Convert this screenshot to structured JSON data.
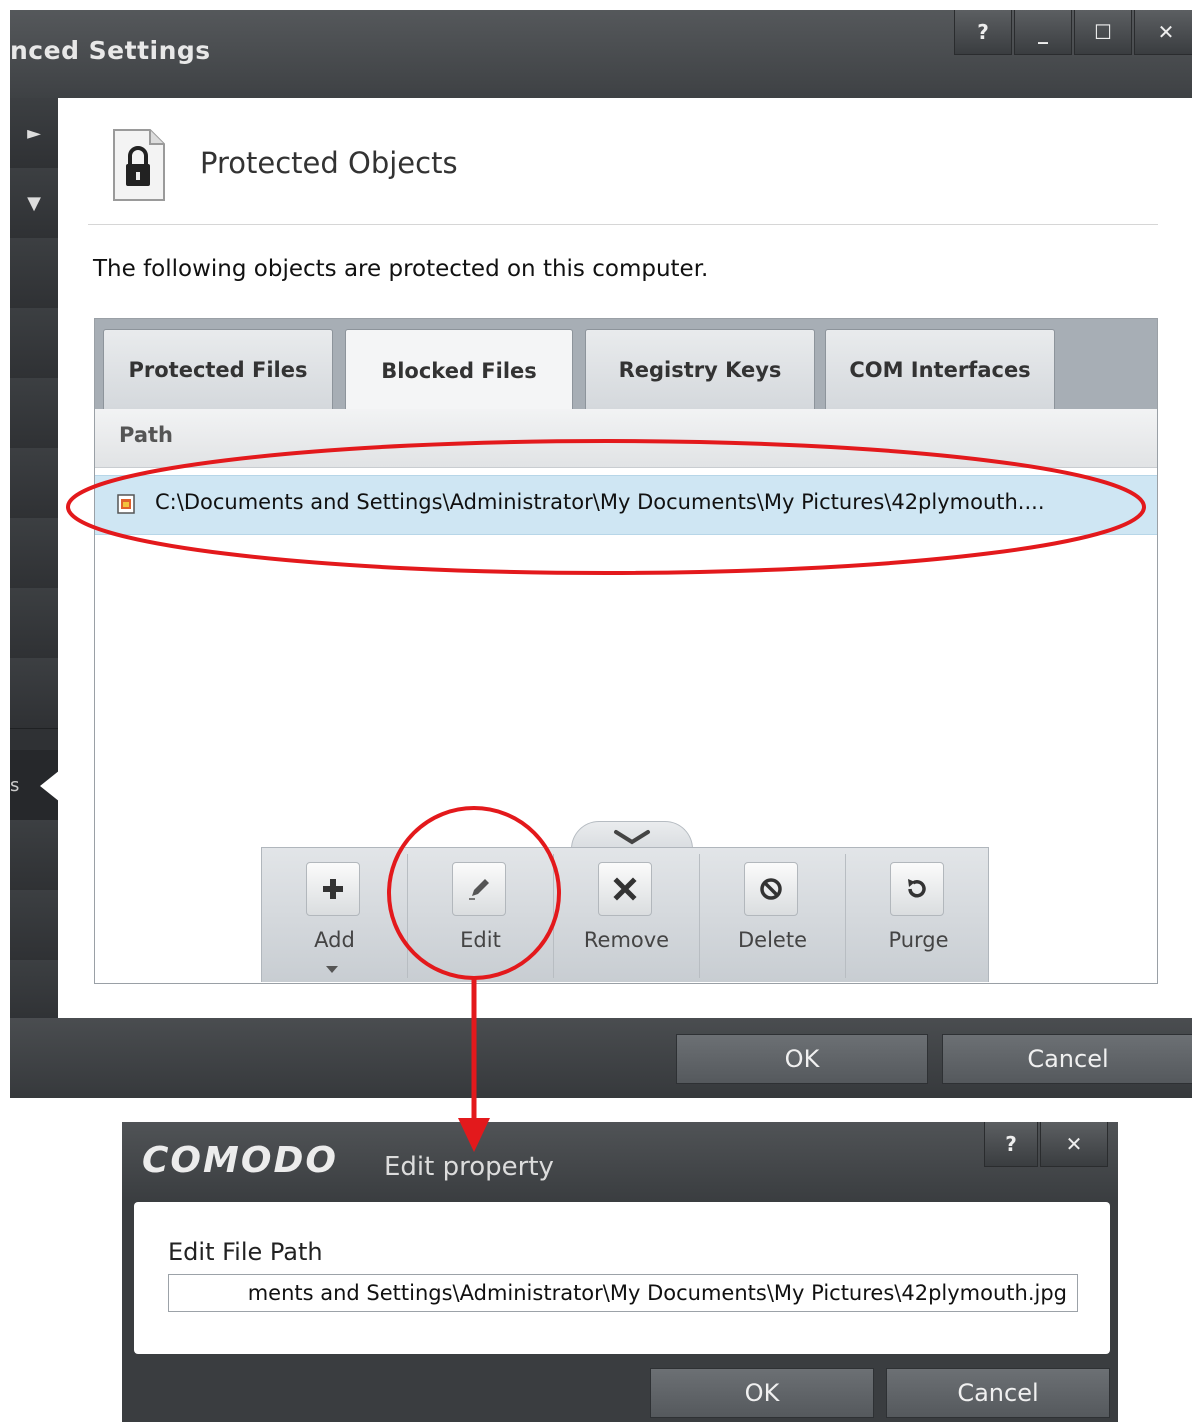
{
  "window": {
    "title": "nced Settings",
    "controls": {
      "help": "?",
      "minimize": "_",
      "maximize": "☐",
      "close": "✕"
    }
  },
  "sidebar": {
    "expand_arrow": "►",
    "collapse_arrow": "▼",
    "selected_fragment": "s"
  },
  "page": {
    "title": "Protected Objects",
    "description": "The following objects are protected on this computer.",
    "header_icon": "lock-document-icon"
  },
  "tabs": [
    {
      "label": "Protected Files",
      "active": false
    },
    {
      "label": "Blocked Files",
      "active": true
    },
    {
      "label": "Registry Keys",
      "active": false
    },
    {
      "label": "COM Interfaces",
      "active": false
    }
  ],
  "table": {
    "column": "Path",
    "rows": [
      {
        "path": "C:\\Documents and Settings\\Administrator\\My Documents\\My Pictures\\42plymouth....",
        "icon": "image-file-icon",
        "selected": true
      }
    ]
  },
  "toolbar": {
    "expander_icon": "chevron-down-icon",
    "buttons": [
      {
        "label": "Add",
        "icon": "plus-icon",
        "has_dropdown": true
      },
      {
        "label": "Edit",
        "icon": "pencil-icon"
      },
      {
        "label": "Remove",
        "icon": "x-icon"
      },
      {
        "label": "Delete",
        "icon": "prohibited-icon"
      },
      {
        "label": "Purge",
        "icon": "refresh-icon"
      }
    ]
  },
  "footer": {
    "ok": "OK",
    "cancel": "Cancel"
  },
  "edit_dialog": {
    "brand": "COMODO",
    "title": "Edit property",
    "controls": {
      "help": "?",
      "close": "✕"
    },
    "field_label": "Edit File Path",
    "field_value": "ments and Settings\\Administrator\\My Documents\\My Pictures\\42plymouth.jpg",
    "ok": "OK",
    "cancel": "Cancel"
  },
  "colors": {
    "annotation": "#e3191c",
    "selection": "#cfe6f3",
    "chrome_dark": "#3b3e41"
  }
}
